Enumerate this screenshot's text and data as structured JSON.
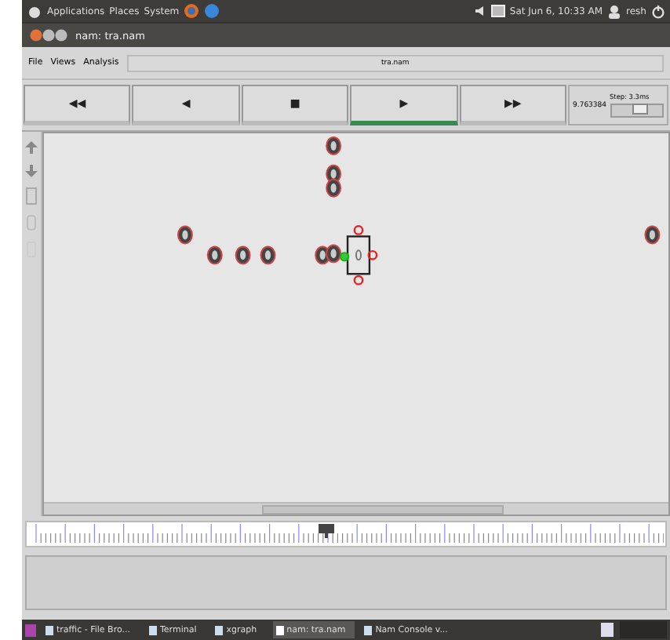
{
  "top_panel": {
    "menus": [
      "Applications",
      "Places",
      "System"
    ],
    "clock": "Sat Jun 6, 10:33 AM",
    "user": "resh"
  },
  "window": {
    "title": "nam: tra.nam"
  },
  "menu_bar": {
    "items": [
      "File",
      "Views",
      "Analysis"
    ],
    "file_name": "tra.nam"
  },
  "playback": {
    "buttons": [
      {
        "label": "◀◀",
        "selected": false
      },
      {
        "label": "◀",
        "selected": false
      },
      {
        "label": "■",
        "selected": false
      },
      {
        "label": "▶",
        "selected": true
      },
      {
        "label": "▶▶",
        "selected": false
      }
    ],
    "time": "9.763384",
    "step": "Step: 3.3ms",
    "step_slider": {
      "level": 0.6
    }
  },
  "taskbar": {
    "items": [
      {
        "label": "traffic - File Bro...",
        "selected": false
      },
      {
        "label": "Terminal",
        "selected": false
      },
      {
        "label": "xgraph",
        "selected": false
      },
      {
        "label": "nam: tra.nam",
        "selected": true
      },
      {
        "label": "Nam Console v...",
        "selected": false
      }
    ]
  }
}
